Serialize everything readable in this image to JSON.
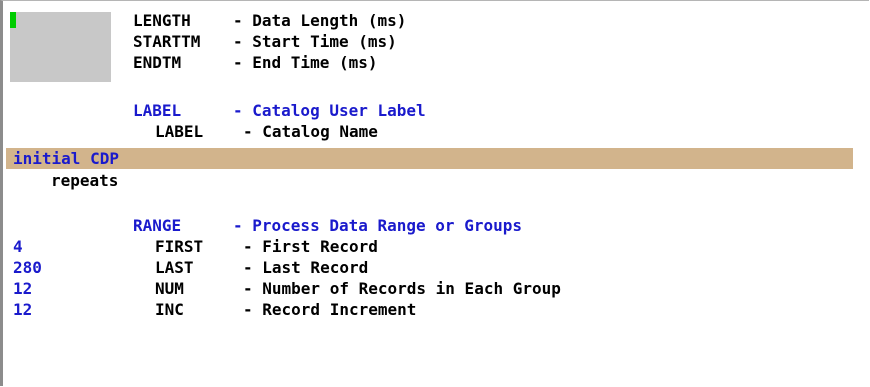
{
  "params": {
    "length": {
      "key": "LENGTH",
      "desc": "- Data Length (ms)"
    },
    "starttm": {
      "key": "STARTTM",
      "desc": "- Start Time (ms)"
    },
    "endtm": {
      "key": "ENDTM",
      "desc": "- End Time (ms)"
    }
  },
  "label_section": {
    "key": "LABEL",
    "desc": "- Catalog User Label",
    "sub": {
      "key": "LABEL",
      "desc": "- Catalog Name"
    }
  },
  "highlight_row": {
    "value": "initial CDP"
  },
  "repeats": "repeats",
  "range_section": {
    "key": "RANGE",
    "desc": "- Process Data Range or Groups",
    "rows": [
      {
        "value": "4",
        "key": "FIRST",
        "desc": "- First Record"
      },
      {
        "value": "280",
        "key": "LAST",
        "desc": "- Last Record"
      },
      {
        "value": "12",
        "key": "NUM",
        "desc": "- Number of Records in Each Group"
      },
      {
        "value": "12",
        "key": "INC",
        "desc": "- Record Increment"
      }
    ]
  },
  "colors": {
    "highlight": "#d2b48c",
    "keyword_blue": "#1a1acc",
    "cursor": "#00cc00"
  }
}
